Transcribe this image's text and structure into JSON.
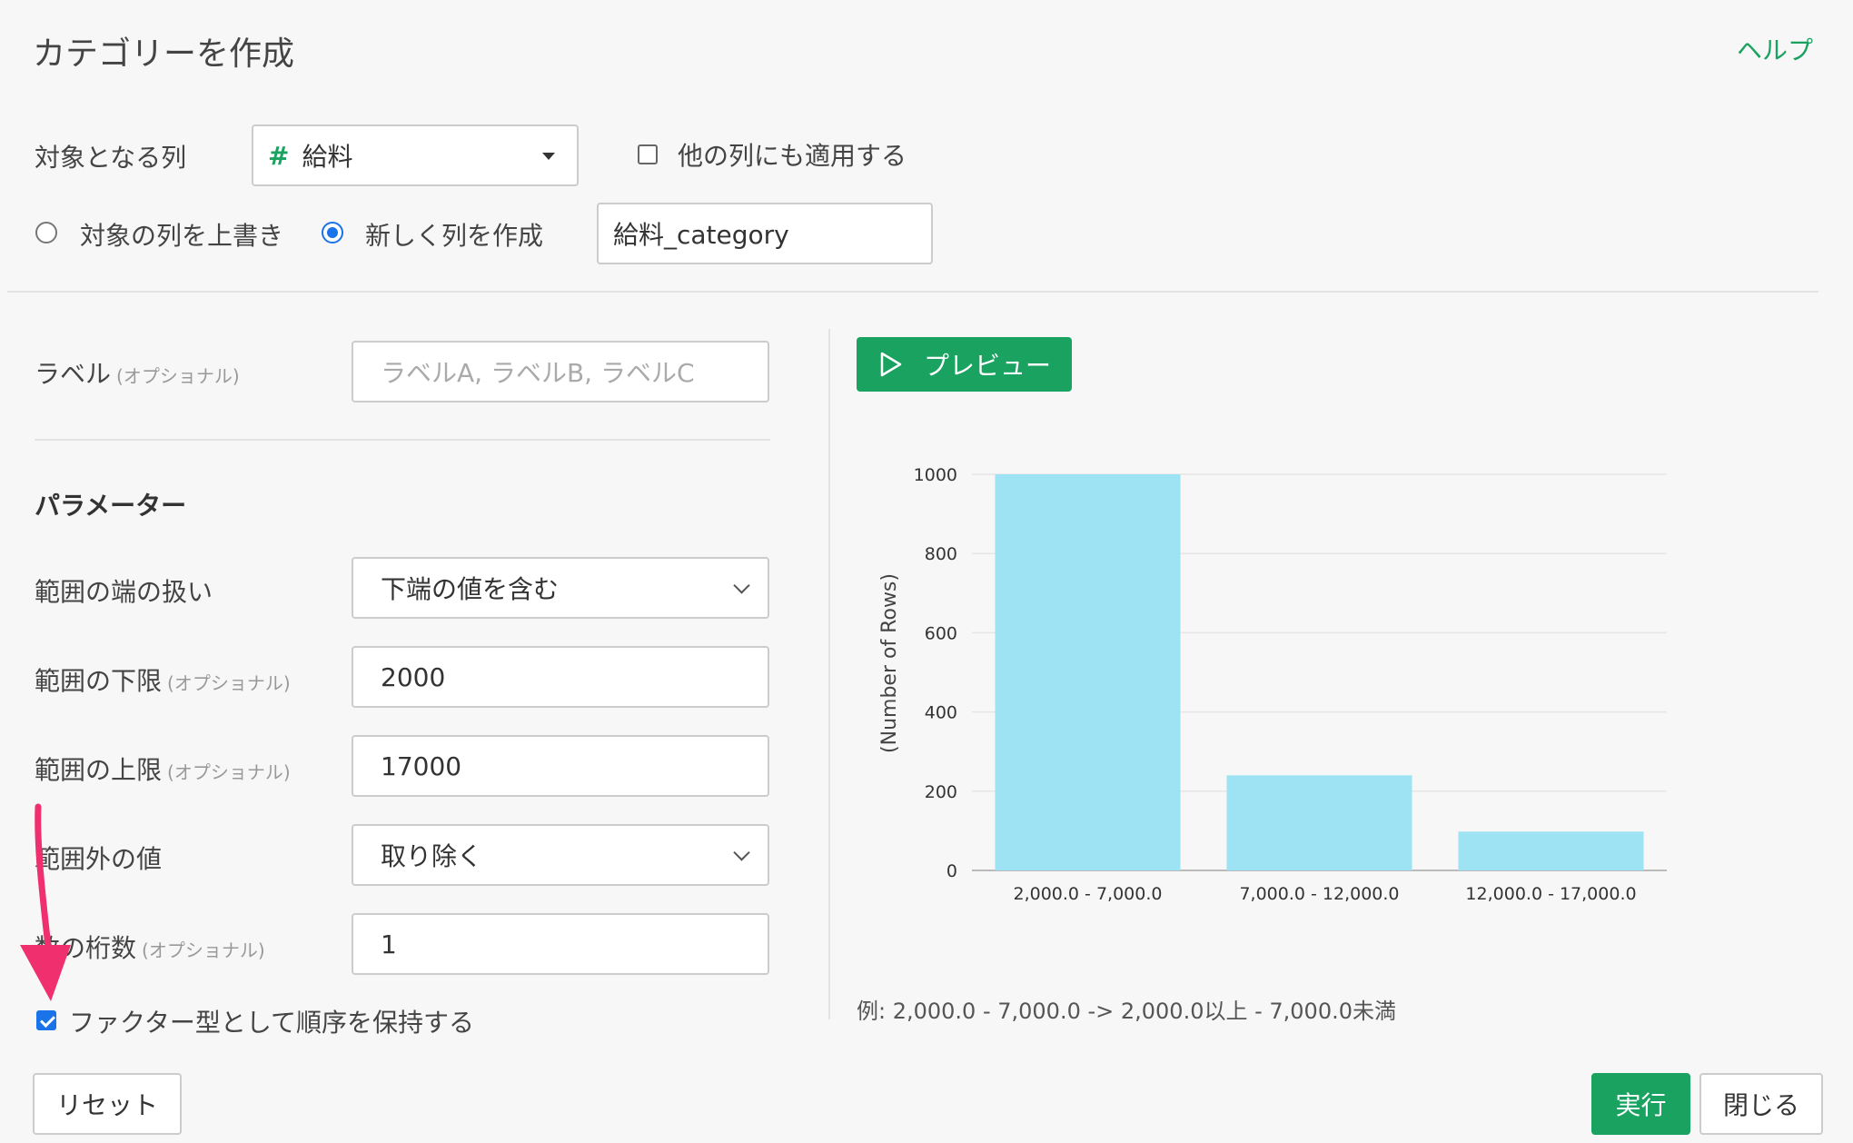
{
  "dialog": {
    "title": "カテゴリーを作成",
    "help_label": "ヘルプ"
  },
  "target": {
    "label": "対象となる列",
    "column_value": "給料",
    "column_type_icon": "#",
    "apply_other_label": "他の列にも適用する",
    "apply_other_checked": false,
    "overwrite_label": "対象の列を上書き",
    "new_column_label": "新しく列を作成",
    "new_column_selected": true,
    "new_column_name": "給料_category"
  },
  "form": {
    "label_label": "ラベル",
    "optional": "(オプショナル)",
    "label_placeholder": "ラベルA, ラベルB, ラベルC",
    "params_title": "パラメーター",
    "range_edge_label": "範囲の端の扱い",
    "range_edge_value": "下端の値を含む",
    "lower_label": "範囲の下限",
    "lower_value": "2000",
    "upper_label": "範囲の上限",
    "upper_value": "17000",
    "outside_label": "範囲外の値",
    "outside_value": "取り除く",
    "digits_label": "数の桁数",
    "digits_value": "1",
    "factor_label": "ファクター型として順序を保持する",
    "factor_checked": true
  },
  "preview": {
    "button_label": "プレビュー",
    "example_text": "例: 2,000.0 - 7,000.0 -> 2,000.0以上 - 7,000.0未満"
  },
  "chart_data": {
    "type": "bar",
    "categories": [
      "2,000.0 - 7,000.0",
      "7,000.0 - 12,000.0",
      "12,000.0 - 17,000.0"
    ],
    "values": [
      1000,
      240,
      98
    ],
    "ylabel": "(Number of Rows)",
    "xlabel": "",
    "ylim": [
      0,
      1000
    ],
    "yticks": [
      0,
      200,
      400,
      600,
      800,
      1000
    ],
    "grid": true,
    "bar_color": "#9de3f3"
  },
  "footer": {
    "reset_label": "リセット",
    "run_label": "実行",
    "close_label": "閉じる"
  },
  "colors": {
    "accent": "#1aa260",
    "radio_checkbox": "#1a73e8",
    "annotation_arrow": "#f0306e"
  }
}
